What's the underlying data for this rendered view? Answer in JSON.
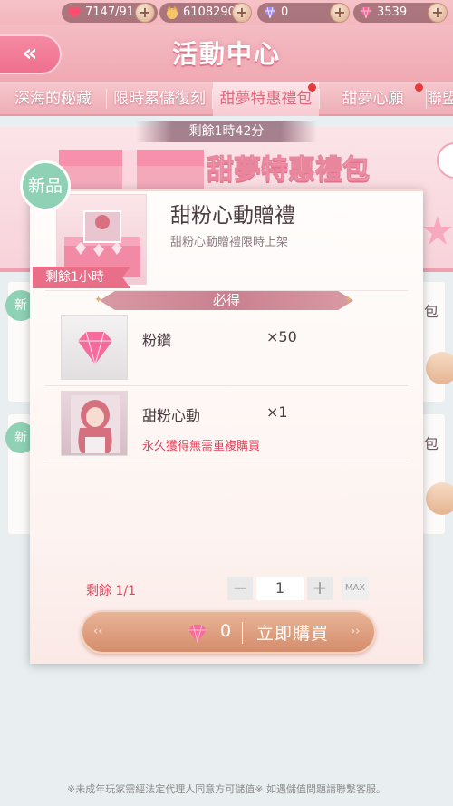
{
  "resources": [
    {
      "icon": "heart-icon",
      "value": "7147/91"
    },
    {
      "icon": "coin-icon",
      "value": "6108290"
    },
    {
      "icon": "purple-gem-icon",
      "value": "0"
    },
    {
      "icon": "pink-diamond-icon",
      "value": "3539"
    }
  ],
  "header": {
    "title": "活動中心",
    "back_icon": "double-chevron-left-icon"
  },
  "tabs": [
    {
      "label": "深海的秘藏",
      "active": false,
      "dot": false
    },
    {
      "label": "限時累儲復刻",
      "active": false,
      "dot": false
    },
    {
      "label": "甜夢特惠禮包",
      "active": true,
      "dot": true
    },
    {
      "label": "甜夢心願",
      "active": false,
      "dot": true
    },
    {
      "label": "聯盟",
      "active": false,
      "dot": false
    }
  ],
  "timer": "剩餘1時42分",
  "banner": {
    "title": "甜夢特惠禮包"
  },
  "background_cards": {
    "new_label": "新",
    "right_labels": [
      "包",
      "包"
    ]
  },
  "modal": {
    "new_badge": "新品",
    "product_title": "甜粉心動贈禮",
    "product_subtitle": "甜粉心動贈禮限時上架",
    "remain_time": "剩餘1小時",
    "guaranteed_label": "必得",
    "items": [
      {
        "name": "粉鑽",
        "qty": "×50",
        "icon": "pink-diamond-icon",
        "note": ""
      },
      {
        "name": "甜粉心動",
        "qty": "×1",
        "icon": "character-portrait",
        "note": "永久獲得無需重複購買"
      }
    ],
    "remaining_count": "剩餘 1/1",
    "quantity": "1",
    "minus_label": "−",
    "plus_label": "+",
    "max_label": "MAX",
    "buy": {
      "price": "0",
      "label": "立即購買",
      "currency_icon": "pink-diamond-icon"
    }
  },
  "footer_notice": "※未成年玩家需經法定代理人同意方可儲值※ 如遇儲值問題請聯繫客服。",
  "colors": {
    "accent_pink": "#e86f87",
    "new_badge": "#8fd1b5",
    "buy_button": "#d48d6c",
    "warning_red": "#e8405a"
  }
}
